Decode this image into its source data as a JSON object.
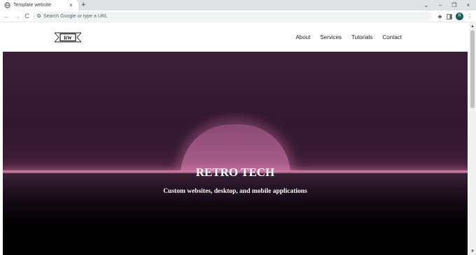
{
  "browser": {
    "tab": {
      "title": "Template website",
      "favicon": "globe-icon",
      "close_glyph": "×"
    },
    "new_tab_glyph": "+",
    "window_controls": {
      "dropdown": "⌄",
      "minimize": "–",
      "restore": "❐",
      "close": "×"
    },
    "nav": {
      "back": "←",
      "forward": "→",
      "reload": "C"
    },
    "omnibox": {
      "g_label": "G",
      "value": "",
      "placeholder": "Search Google or type a URL"
    },
    "toolbar_icons": {
      "extensions": "puzzle-icon",
      "side_panel": "side-panel-icon",
      "menu": "⋮"
    },
    "profile_initial": "R"
  },
  "site": {
    "logo_text": "RW",
    "nav": [
      {
        "label": "About"
      },
      {
        "label": "Services"
      },
      {
        "label": "Tutorials"
      },
      {
        "label": "Contact"
      }
    ],
    "hero": {
      "title": "RETRO TECH",
      "subtitle": "Custom websites, desktop, and mobile applications"
    }
  },
  "scrollbar": {
    "up": "▲",
    "down": "▼"
  },
  "colors": {
    "hero_sky": "#331830",
    "sun": "#a35b86",
    "horizon": "#d48bb0",
    "ground": "#000000",
    "profile": "#1a5b57"
  }
}
